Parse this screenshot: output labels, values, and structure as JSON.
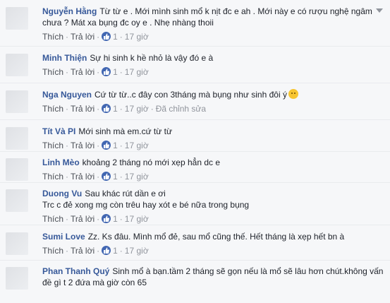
{
  "actions": {
    "like": "Thích",
    "reply": "Trả lời",
    "edited": "Đã chỉnh sửa"
  },
  "comments": [
    {
      "author": "Nguyễn Hằng",
      "text": "Từ từ e . Mới mình sinh mổ k nịt đc e ah . Mới này e có rượu nghệ ngâm chưa ? Mát xa bụng đc oy e . Nhẹ nhàng thoii",
      "likes": "1",
      "time": "17 giờ"
    },
    {
      "author": "Minh Thiện",
      "text": "Sự hi sinh k hề nhỏ là vậy đó e à",
      "likes": "1",
      "time": "17 giờ"
    },
    {
      "author": "Nga Nguyen",
      "text": "Cứ từ từ..c đây con 3tháng mà bụng như sinh đôi ý",
      "likes": "1",
      "time": "17 giờ"
    },
    {
      "author": "Tít Và PI",
      "text": "Mới sinh mà em.cứ từ từ",
      "likes": "1",
      "time": "17 giờ"
    },
    {
      "author": "Linh Mèo",
      "text": "khoảng 2 tháng nó mới xẹp hẳn dc e",
      "likes": "1",
      "time": "17 giờ"
    },
    {
      "author": "Duong Vu",
      "text": "Sau khác rút dần e ơi",
      "text2": "Trc c đẻ xong mg còn trêu hay xót e bé nữa trong bụng",
      "likes": "1",
      "time": "17 giờ"
    },
    {
      "author": "Sumi Love",
      "text": "Zz. Ks đâu. Mình mổ đẻ, sau mổ cũng thế. Hết tháng là xẹp hết bn à",
      "likes": "1",
      "time": "17 giờ"
    },
    {
      "author": "Phan Thanh Quý",
      "text": "Sinh mổ à bạn.tầm 2 tháng sẽ gọn nếu là mổ sẽ lâu hơn chút.không vấn đề gì t 2 đứa mà giờ còn 65",
      "likes": "1",
      "time": "17 giờ"
    }
  ]
}
